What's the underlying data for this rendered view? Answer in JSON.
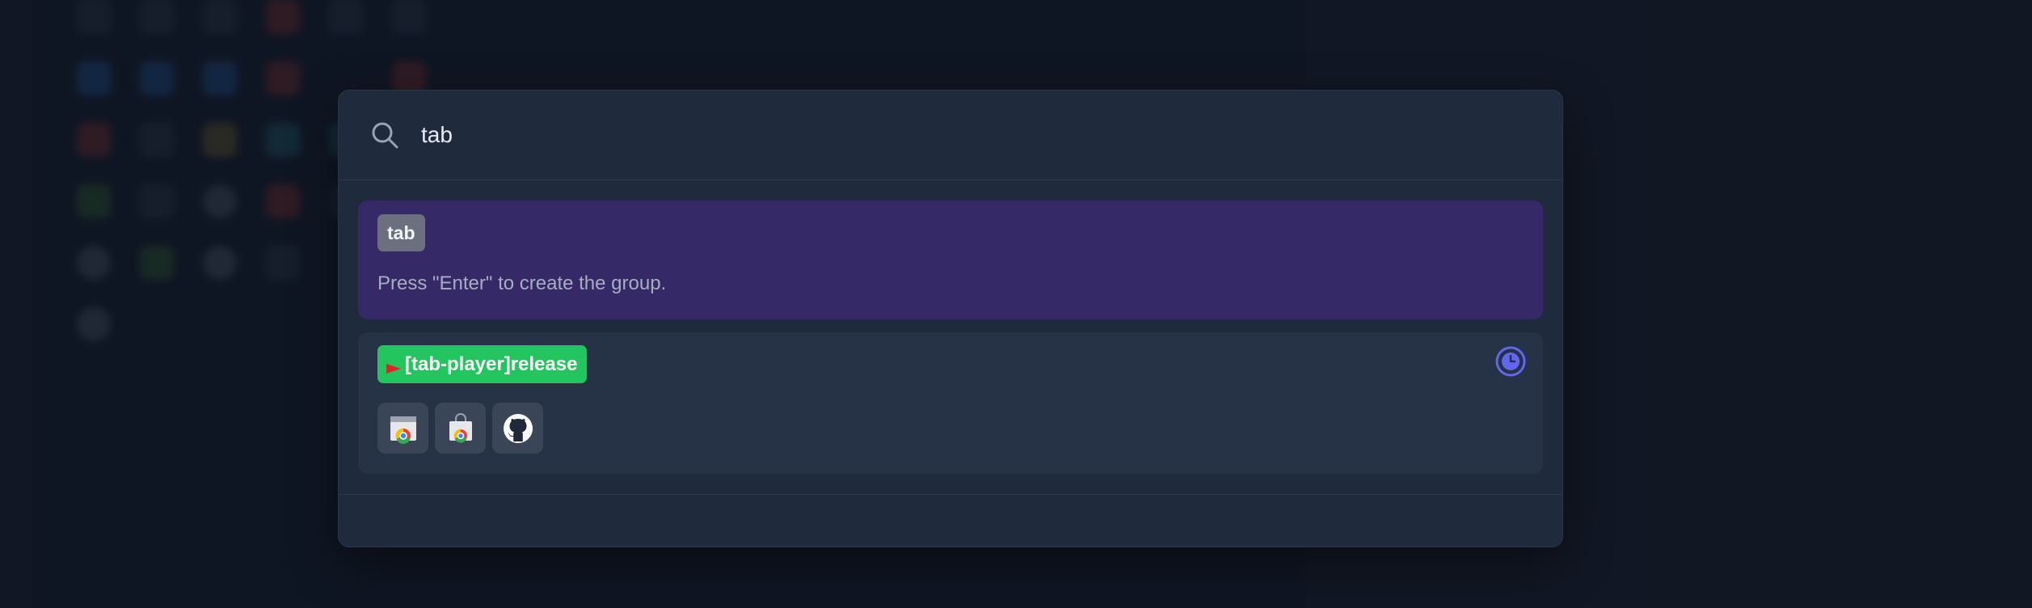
{
  "search": {
    "value": "tab",
    "icon": "search-icon"
  },
  "create_group": {
    "tag_label": "tab",
    "hint": "Press \"Enter\" to create the group.",
    "background": "#352968"
  },
  "groups": [
    {
      "label": "[tab-player]release",
      "color": "#22c55e",
      "flag_icon": "red-flag-icon",
      "status_icon": "clock-icon",
      "tabs": [
        {
          "icon": "chrome-web-store-icon"
        },
        {
          "icon": "chrome-web-store-bag-icon"
        },
        {
          "icon": "github-icon"
        }
      ]
    }
  ],
  "colors": {
    "accent_purple": "#352968",
    "accent_green": "#22c55e",
    "clock_indigo": "#6366f1",
    "panel": "#1f2a3c"
  }
}
